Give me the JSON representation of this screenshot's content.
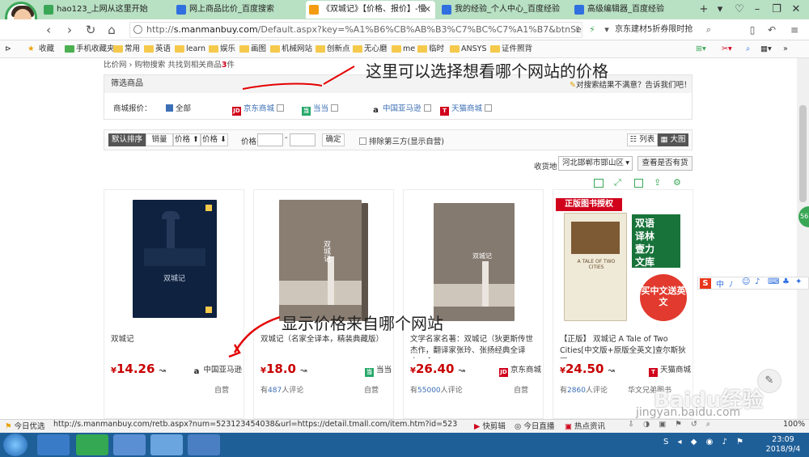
{
  "browser": {
    "tabs": [
      {
        "label": "hao123_上网从这里开始",
        "color": "#3aa757"
      },
      {
        "label": "网上商品比价_百度搜索",
        "color": "#2f6fe0"
      },
      {
        "label": "《双城记》【价格、报价】-慢",
        "color": "#f39c12"
      },
      {
        "label": "我的经验_个人中心_百度经验",
        "color": "#2f6fe0"
      },
      {
        "label": "高级编辑器_百度经验",
        "color": "#2f6fe0"
      }
    ],
    "url_scheme": "http://",
    "url_domain": "s.manmanbuy.com",
    "url_rest": "/Default.aspx?key=%A1%B6%CB%AB%B3%C7%BC%C7%A1%B7&btnSear",
    "promo": "京东建材5折券限时抢",
    "bookmarks": [
      "收藏",
      "手机收藏夹",
      "常用",
      "英语",
      "learn",
      "娱乐",
      "画图",
      "机械网站",
      "创新点",
      "无心磨",
      "me",
      "临时",
      "ANSYS",
      "证件照背"
    ]
  },
  "page": {
    "crumb_prefix": "比价网 › 购物搜索  共找到相关商品",
    "crumb_count": "3",
    "crumb_suffix": "件",
    "filter_title": "筛选商品",
    "feedback": "对搜索结果不满意？告诉我们吧！",
    "store_filter_label": "商城报价：",
    "store_all": "全部",
    "stores": [
      {
        "name": "京东商城",
        "logo": "JD",
        "color": "#d0021b"
      },
      {
        "name": "当当",
        "logo": "当",
        "color": "#27a86a"
      },
      {
        "name": "中国亚马逊",
        "logo": "a",
        "color": "#222222"
      },
      {
        "name": "天猫商城",
        "logo": "T",
        "color": "#d0021b"
      }
    ],
    "sort": {
      "default": "默认排序",
      "sales": "销量",
      "price_up": "价格 ⬆",
      "price_down": "价格 ⬇",
      "price_label": "价格",
      "confirm": "确定",
      "exclude": "排除第三方(显示自营)",
      "view_list": "列表",
      "view_grid": "大图"
    },
    "location_label": "收货地",
    "location_value": "河北邯郸市邯山区",
    "check_stock": "查看是否有货",
    "products": [
      {
        "title": "双城记",
        "price": "14.26",
        "store": "中国亚马逊",
        "review_prefix": "",
        "review_count": "",
        "review_suffix": "",
        "self": "自营"
      },
      {
        "title": "双城记（名家全译本，精装典藏版）",
        "price": "18.0",
        "store": "当当",
        "review_prefix": "有",
        "review_count": "487",
        "review_suffix": "人评论",
        "self": "自营"
      },
      {
        "title": "文学名家名著：双城记（狄更斯传世杰作，翻译家张玲、张扬经典全译本，全",
        "price": "26.40",
        "store": "京东商城",
        "review_prefix": "有",
        "review_count": "55000",
        "review_suffix": "人评论",
        "self": "自营"
      },
      {
        "title": "【正版】 双城记 A Tale of Two Cities[中文版+原版全英文]查尔斯狄更",
        "price": "24.50",
        "store": "天猫商城",
        "review_prefix": "有",
        "review_count": "2860",
        "review_suffix": "人评论",
        "self": "华文兄弟图书"
      }
    ],
    "book_badge": "正版图书授权",
    "book4_side": [
      "双语",
      "译林",
      "壹力",
      "文库"
    ],
    "book4_stamp": "买中文送英文",
    "book_title_cn": "双城记",
    "book_sub": "A TALE OF TWO CITIES"
  },
  "annotations": {
    "top": "这里可以选择想看哪个网站的价格",
    "middle": "显示价格来自哪个网站"
  },
  "status": {
    "today": "今日优选",
    "link": "http://s.manmanbuy.com/retb.aspx?num=523123454038&url=https://detail.tmall.com/item.htm?id=523123454038",
    "quick": "快剪辑",
    "live": "今日直播",
    "news": "热点资讯",
    "zoom": "100%"
  },
  "taskbar": {
    "time": "23:09",
    "date": "2018/9/4"
  },
  "watermark": "Baidu经验",
  "watermark_url": "jingyan.baidu.com"
}
